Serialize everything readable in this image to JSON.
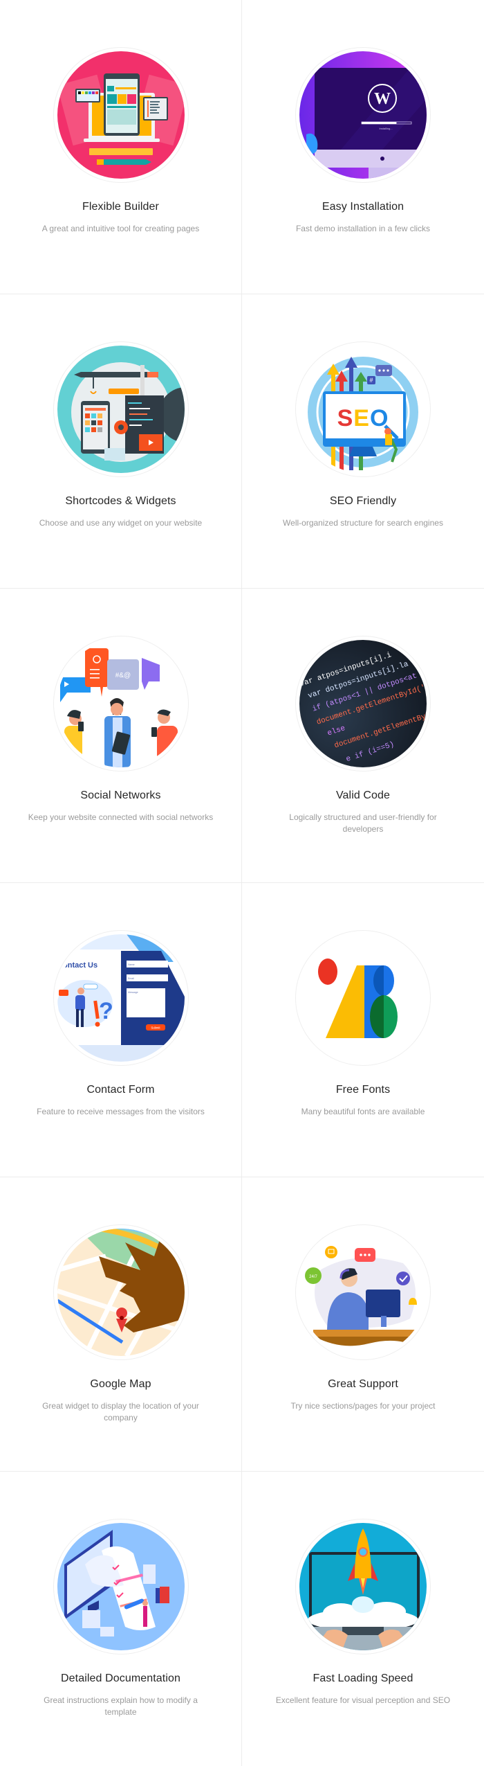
{
  "features": [
    {
      "title": "Flexible Builder",
      "description": "A great and intuitive tool for creating pages",
      "illustration": "page-builder-illustration",
      "accent": "#f2306b"
    },
    {
      "title": "Easy Installation",
      "description": "Fast demo installation in a few clicks",
      "illustration": "wordpress-install-illustration",
      "accent": "#6c1ae0",
      "progress_label": "Installing...",
      "progress": 0.7
    },
    {
      "title": "Shortcodes & Widgets",
      "description": "Choose and use any widget on your website",
      "illustration": "widgets-illustration",
      "accent": "#5fd0d3"
    },
    {
      "title": "SEO Friendly",
      "description": "Well-organized structure for search engines",
      "illustration": "seo-illustration",
      "accent": "#8fd0f2",
      "screen_text": "SEO"
    },
    {
      "title": "Social Networks",
      "description": "Keep your website connected with social networks",
      "illustration": "social-networks-illustration",
      "accent": "#ff6a1a",
      "bubble_text": "#&@"
    },
    {
      "title": "Valid Code",
      "description": "Logically structured and user-friendly for developers",
      "illustration": "code-illustration",
      "accent": "#1b2430",
      "code_lines": [
        "var atpos=inputs[i].i",
        "var dotpos=inputs[i].la",
        "if (atpos<1 || dotpos<at",
        "document.getElementById('",
        "else",
        "document.getElementById(",
        "e if (i==5)"
      ]
    },
    {
      "title": "Contact Form",
      "description": "Feature to receive messages from the visitors",
      "illustration": "contact-form-illustration",
      "accent": "#1e3a8a",
      "form_heading": "ontact Us",
      "form_fields": [
        "Name",
        "Email",
        "Message"
      ],
      "form_button": "Submit"
    },
    {
      "title": "Free Fonts",
      "description": "Many beautiful fonts are available",
      "illustration": "google-fonts-logo",
      "accent": "#1a73e8"
    },
    {
      "title": "Google Map",
      "description": "Great widget to display the location of your company",
      "illustration": "map-pin-illustration",
      "accent": "#e53935"
    },
    {
      "title": "Great Support",
      "description": "Try nice sections/pages for your project",
      "illustration": "support-agent-illustration",
      "accent": "#5b7fd6",
      "badge_text": "24/7"
    },
    {
      "title": "Detailed Documentation",
      "description": "Great instructions explain how to modify a template",
      "illustration": "documentation-illustration",
      "accent": "#7fb4ff"
    },
    {
      "title": "Fast Loading Speed",
      "description": "Excellent feature for visual perception and SEO",
      "illustration": "rocket-laptop-illustration",
      "accent": "#12acd8"
    }
  ]
}
